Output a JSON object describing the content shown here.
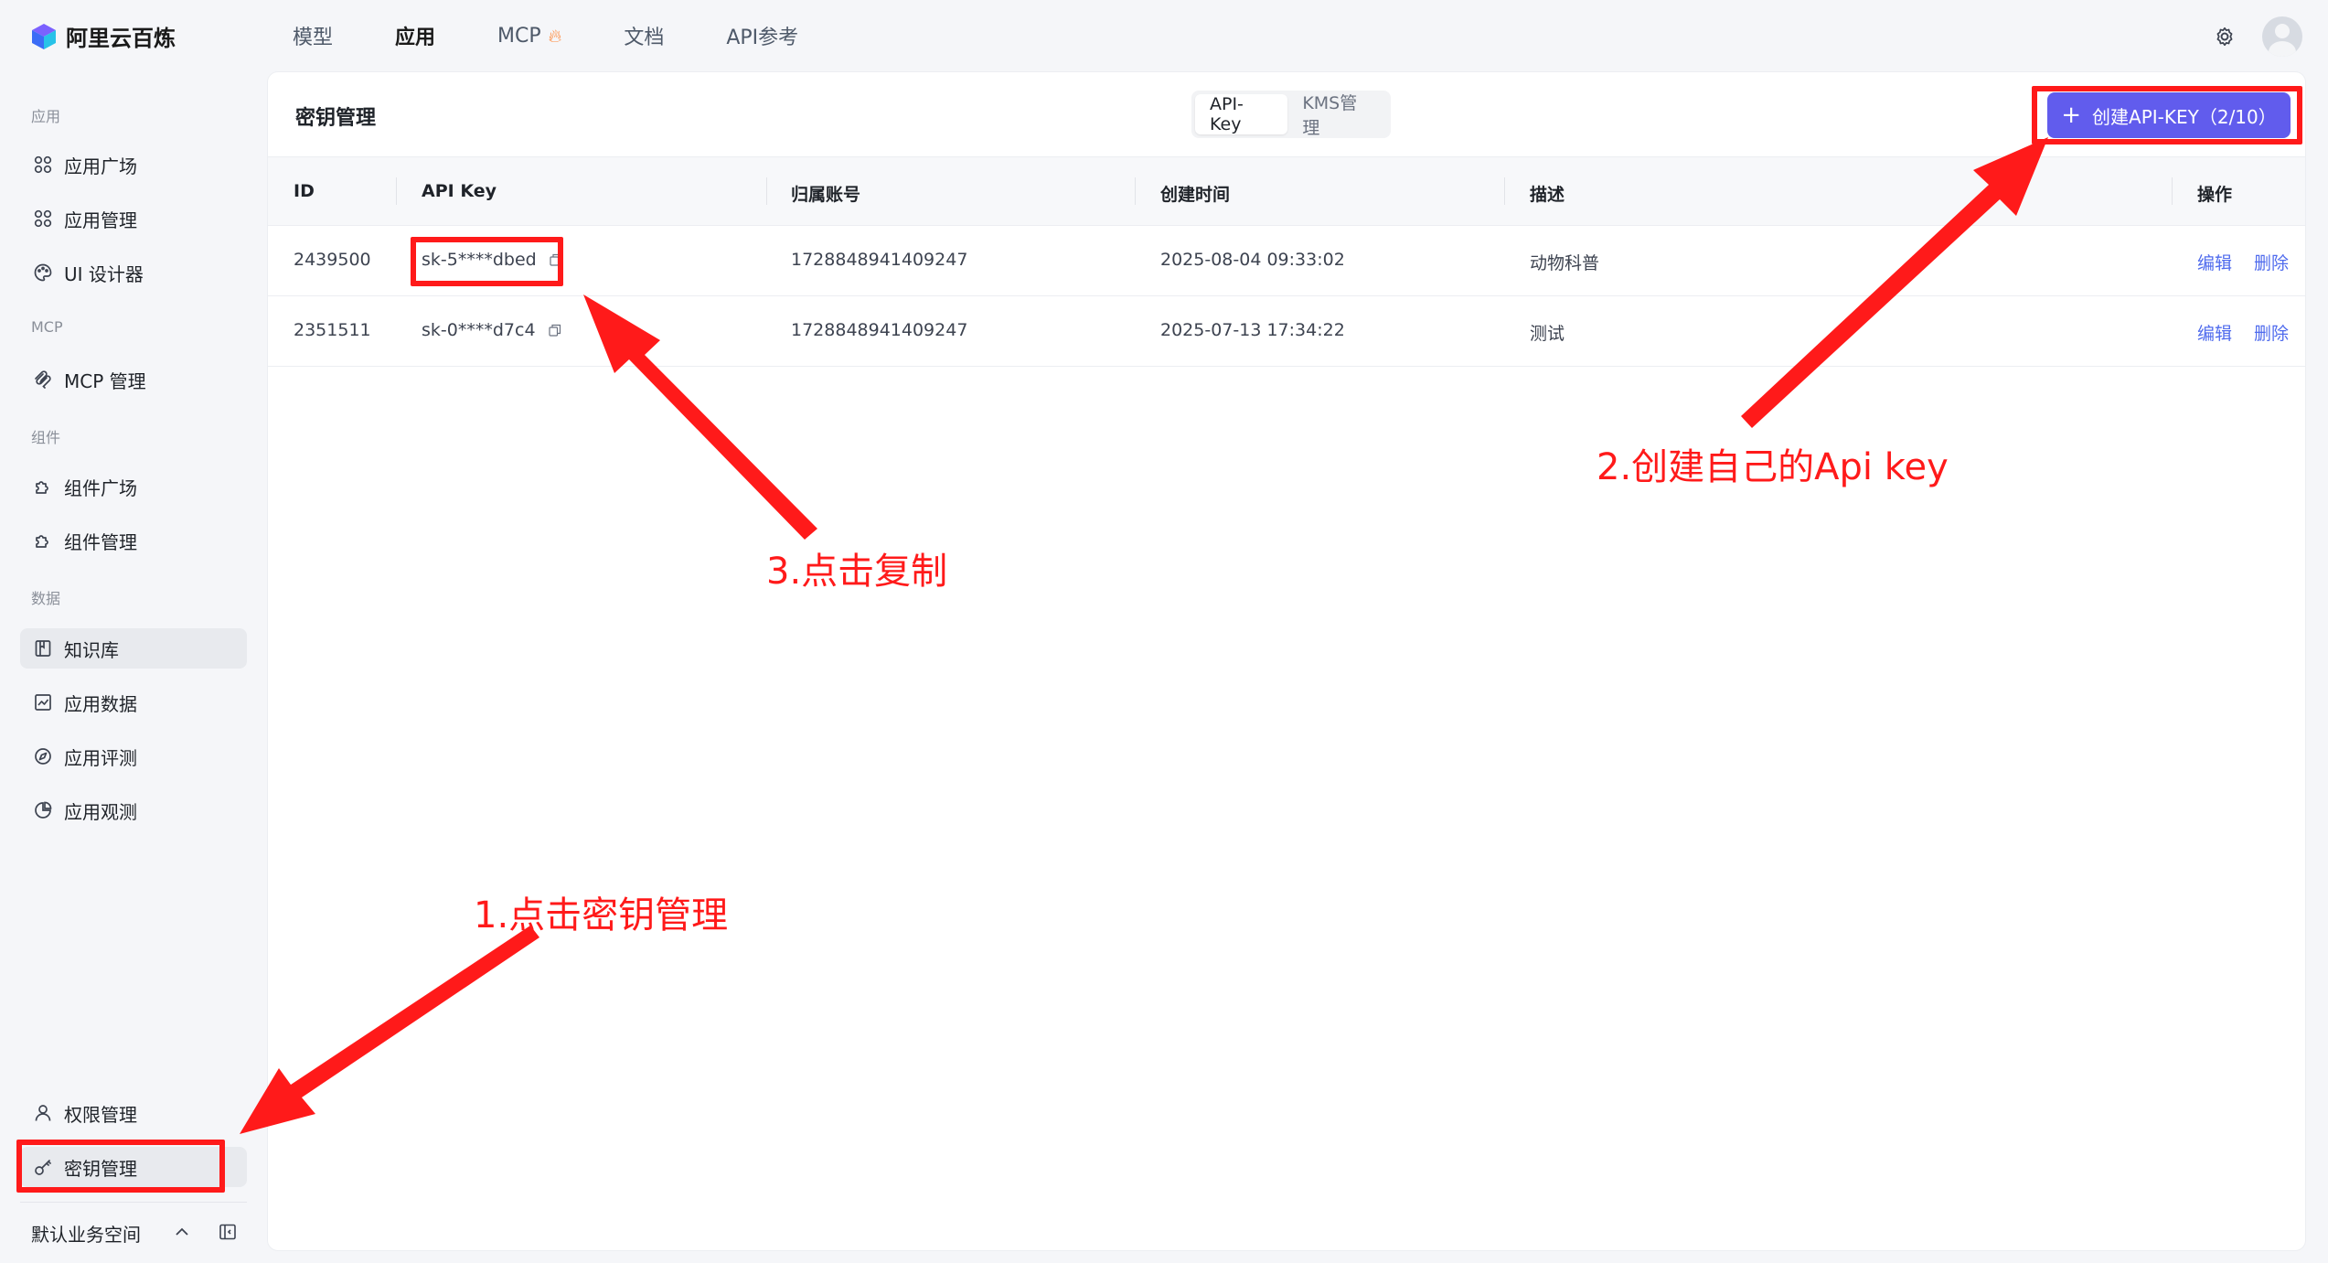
{
  "brand": {
    "name": "阿里云百炼"
  },
  "topnav": [
    {
      "label": "模型",
      "active": false
    },
    {
      "label": "应用",
      "active": true
    },
    {
      "label": "MCP",
      "active": false,
      "badge_icon": "flame-icon"
    },
    {
      "label": "文档",
      "active": false
    },
    {
      "label": "API参考",
      "active": false
    }
  ],
  "sidebar": {
    "sections": {
      "app": "应用",
      "mcp": "MCP",
      "component": "组件",
      "data": "数据"
    },
    "items": [
      {
        "label": "应用广场",
        "icon": "grid-icon"
      },
      {
        "label": "应用管理",
        "icon": "grid-icon"
      },
      {
        "label": "UI 设计器",
        "icon": "palette-icon"
      },
      {
        "label": "MCP 管理",
        "icon": "mcp-icon"
      },
      {
        "label": "组件广场",
        "icon": "puzzle-icon"
      },
      {
        "label": "组件管理",
        "icon": "puzzle-icon"
      },
      {
        "label": "知识库",
        "icon": "book-icon"
      },
      {
        "label": "应用数据",
        "icon": "chart-icon"
      },
      {
        "label": "应用评测",
        "icon": "compass-icon"
      },
      {
        "label": "应用观测",
        "icon": "pie-icon"
      },
      {
        "label": "权限管理",
        "icon": "user-icon"
      },
      {
        "label": "密钥管理",
        "icon": "key-icon"
      }
    ],
    "workspace": "默认业务空间"
  },
  "main": {
    "title": "密钥管理",
    "tabs": [
      {
        "label": "API-Key",
        "active": true
      },
      {
        "label": "KMS管理",
        "active": false
      }
    ],
    "create_button": "创建API-KEY（2/10）",
    "columns": [
      "ID",
      "API Key",
      "归属账号",
      "创建时间",
      "描述",
      "操作"
    ],
    "rows": [
      {
        "id": "2439500",
        "key": "sk-5****dbed",
        "account": "1728848941409247",
        "created": "2025-08-04 09:33:02",
        "desc": "动物科普",
        "edit": "编辑",
        "delete": "删除"
      },
      {
        "id": "2351511",
        "key": "sk-0****d7c4",
        "account": "1728848941409247",
        "created": "2025-07-13 17:34:22",
        "desc": "测试",
        "edit": "编辑",
        "delete": "删除"
      }
    ]
  },
  "annotations": {
    "step1": "1.点击密钥管理",
    "step2": "2.创建自己的Api key",
    "step3": "3.点击复制",
    "color": "#ff1a1a"
  },
  "colors": {
    "accent": "#615ced",
    "link": "#4f6bed",
    "annotation": "#ff1a1a"
  }
}
